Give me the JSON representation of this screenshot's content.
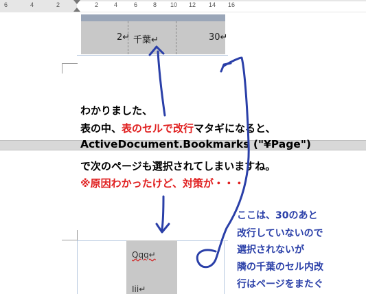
{
  "ruler": {
    "left_numbers": [
      "6",
      "4",
      "2"
    ],
    "right_numbers": [
      "2",
      "4",
      "6",
      "8",
      "10",
      "12",
      "14",
      "16"
    ]
  },
  "table_page1": {
    "cell_left_text": "2↵",
    "cell_mid_text": "千葉↵",
    "cell_right_text": "30↵"
  },
  "message": {
    "line1": "わかりました、",
    "line2_prefix": "表の中、",
    "line2_red": "表のセルで改行",
    "line2_suffix": "マタギになると、",
    "line3": "ActiveDocument.Bookmarks (\"¥Page\")",
    "line4": "で次のページも選択されてしまいますね。",
    "line5": "※原因わかったけど、対策が・・・"
  },
  "table_page2": {
    "cell_text1": "Qqq↵",
    "cell_text2": "Iii↵"
  },
  "annotation": {
    "line1": "ここは、30のあと",
    "line2": "改行していないので",
    "line3": "選択されないが",
    "line4": "隣の千葉のセル内改",
    "line5": "行はページをまたぐ"
  },
  "colors": {
    "ink_blue": "#2a3fa8",
    "accent_red": "#e02020",
    "cell_shade": "#c8c8c8"
  }
}
